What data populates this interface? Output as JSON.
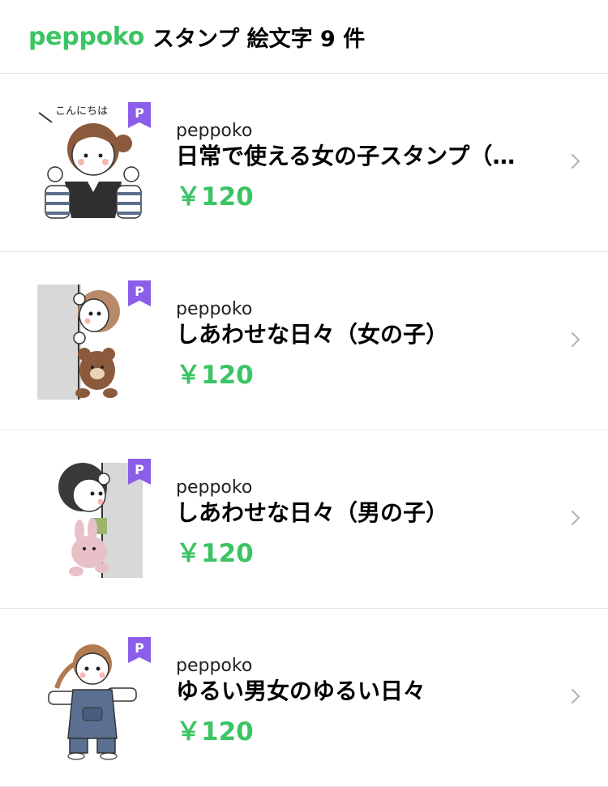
{
  "header": {
    "brand": "peppoko",
    "title": "スタンプ 絵文字 9 件"
  },
  "items": [
    {
      "author": "peppoko",
      "title": "日常で使える女の子スタンプ（…",
      "price": "￥120",
      "badge": "P",
      "thumb_icon": "girl-waving-sticker-icon",
      "speech": "こんにちは"
    },
    {
      "author": "peppoko",
      "title": "しあわせな日々（女の子）",
      "price": "￥120",
      "badge": "P",
      "thumb_icon": "girl-peeking-with-bear-sticker-icon"
    },
    {
      "author": "peppoko",
      "title": "しあわせな日々（男の子）",
      "price": "￥120",
      "badge": "P",
      "thumb_icon": "boy-peeking-with-bunny-sticker-icon"
    },
    {
      "author": "peppoko",
      "title": "ゆるい男女のゆるい日々",
      "price": "￥120",
      "badge": "P",
      "thumb_icon": "girl-overalls-sticker-icon"
    }
  ],
  "colors": {
    "accent": "#3bc463",
    "premium": "#8a5ee8",
    "divider": "#e6e6e6"
  }
}
